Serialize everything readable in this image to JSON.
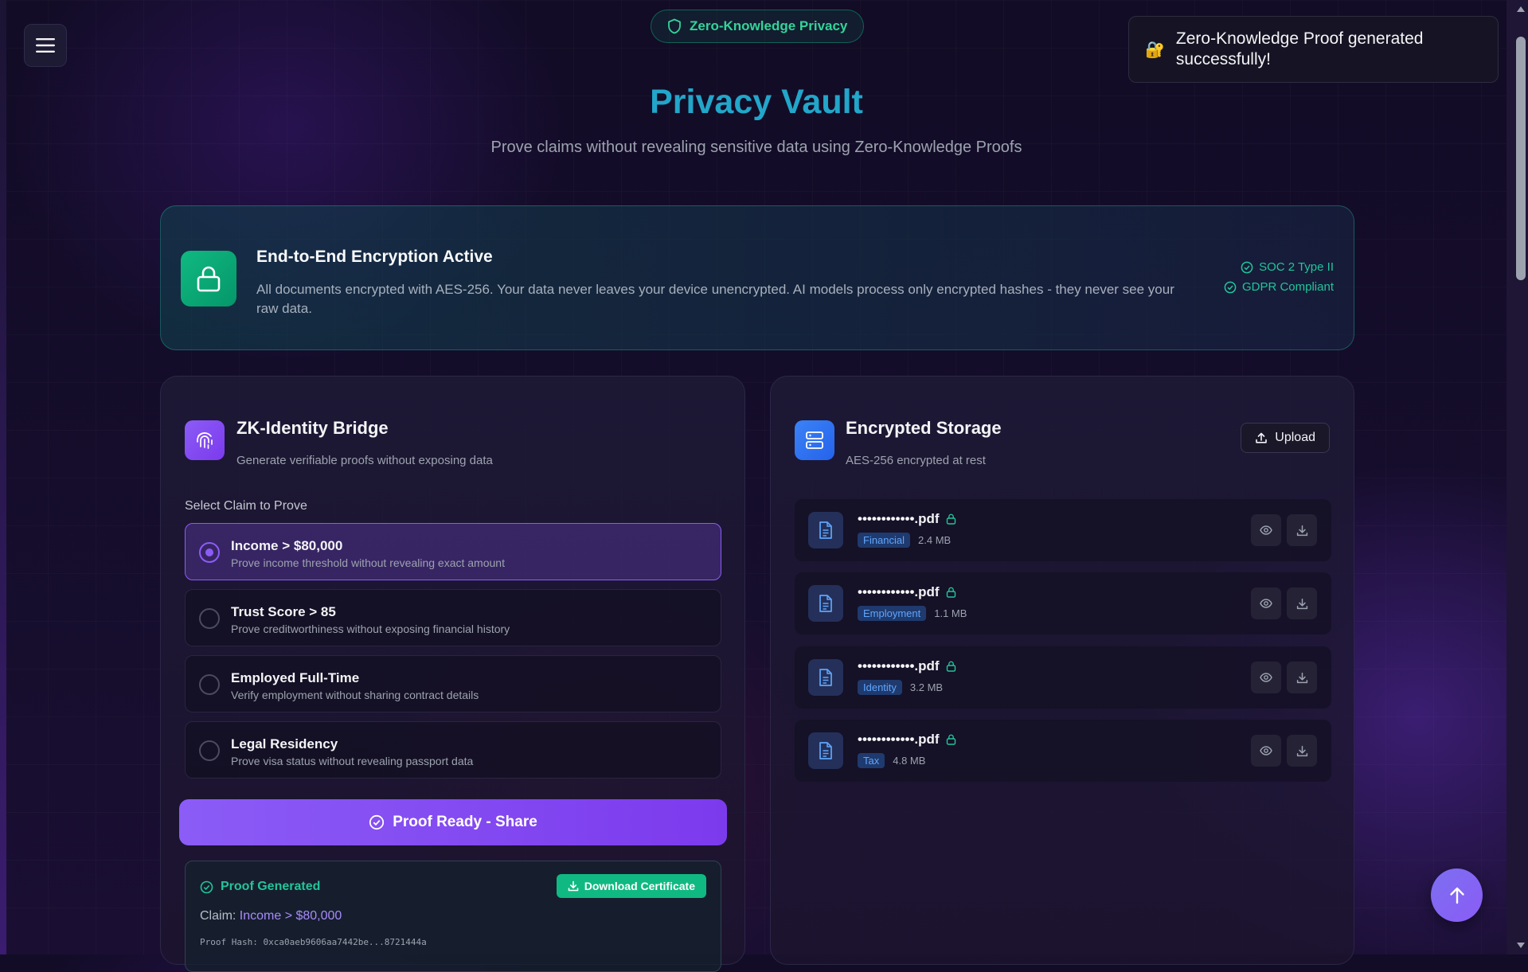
{
  "top_pill": {
    "label": "Zero-Knowledge Privacy",
    "icon": "shield-icon"
  },
  "toast": {
    "emoji": "🔐",
    "message": "Zero-Knowledge Proof generated successfully!"
  },
  "hero": {
    "title": "Privacy Vault",
    "subtitle": "Prove claims without revealing sensitive data using Zero-Knowledge Proofs"
  },
  "encryption": {
    "icon": "lock-icon",
    "title": "End-to-End Encryption Active",
    "description": "All documents encrypted with AES-256. Your data never leaves your device unencrypted. AI models process only encrypted hashes - they never see your raw data.",
    "badges": [
      "SOC 2 Type II",
      "GDPR Compliant"
    ]
  },
  "identity": {
    "icon": "fingerprint-icon",
    "title": "ZK-Identity Bridge",
    "subtitle": "Generate verifiable proofs without exposing data",
    "claims_label": "Select Claim to Prove",
    "claims": [
      {
        "title": "Income > $80,000",
        "desc": "Prove income threshold without revealing exact amount",
        "selected": true
      },
      {
        "title": "Trust Score > 85",
        "desc": "Prove creditworthiness without exposing financial history",
        "selected": false
      },
      {
        "title": "Employed Full-Time",
        "desc": "Verify employment without sharing contract details",
        "selected": false
      },
      {
        "title": "Legal Residency",
        "desc": "Prove visa status without revealing passport data",
        "selected": false
      }
    ],
    "action_button": "Proof Ready - Share",
    "proof": {
      "status": "Proof Generated",
      "download_label": "Download Certificate",
      "claim_label": "Claim: ",
      "claim_value": "Income > $80,000",
      "hash_label": "Proof Hash: ",
      "hash_value": "0xca0aeb9606aa7442be...8721444a"
    }
  },
  "storage": {
    "icon": "server-icon",
    "title": "Encrypted Storage",
    "subtitle": "AES-256 encrypted at rest",
    "upload_label": "Upload",
    "documents": [
      {
        "name": "••••••••••••.pdf",
        "tag": "Financial",
        "size": "2.4 MB"
      },
      {
        "name": "••••••••••••.pdf",
        "tag": "Employment",
        "size": "1.1 MB"
      },
      {
        "name": "••••••••••••.pdf",
        "tag": "Identity",
        "size": "3.2 MB"
      },
      {
        "name": "••••••••••••.pdf",
        "tag": "Tax",
        "size": "4.8 MB"
      }
    ]
  },
  "colors": {
    "accent_purple": "#8b5cf6",
    "accent_green": "#10b981",
    "title_cyan": "#22a6c9",
    "tag_blue": "#60a5fa"
  }
}
